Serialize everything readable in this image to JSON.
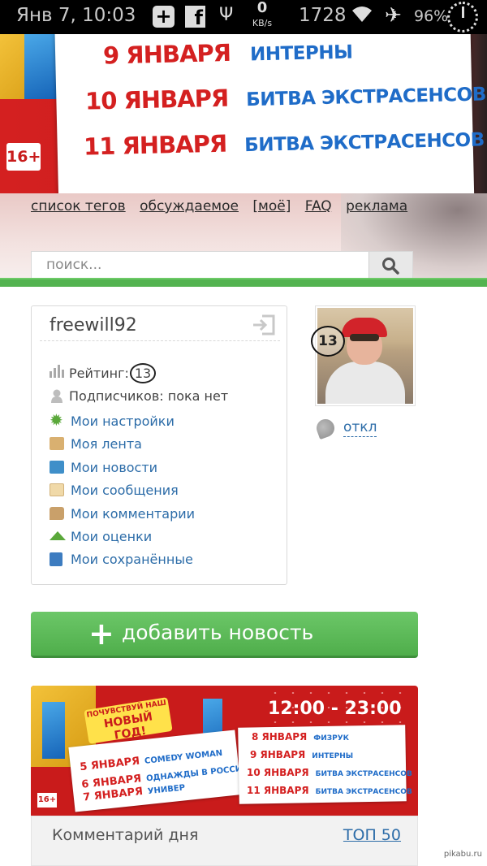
{
  "statusbar": {
    "datetime": "Янв 7, 10:03",
    "speed_value": "0",
    "speed_unit": "KB/s",
    "counter": "1728",
    "battery": "96%"
  },
  "banner": {
    "rows": [
      {
        "date": "9 ЯНВАРЯ",
        "show": "ИНТЕРНЫ"
      },
      {
        "date": "10 ЯНВАРЯ",
        "show": "БИТВА ЭКСТРАСЕНСОВ"
      },
      {
        "date": "11 ЯНВАРЯ",
        "show": "БИТВА ЭКСТРАСЕНСОВ"
      }
    ],
    "age": "16+"
  },
  "nav": {
    "items": [
      "список тегов",
      "обсуждаемое",
      "[моё]",
      "FAQ",
      "реклама"
    ]
  },
  "search": {
    "placeholder": "поиск..."
  },
  "profile": {
    "username": "freewill92",
    "rating_label": "Рейтинг:",
    "rating_value": "13",
    "subscribers": "Подписчиков: пока нет",
    "menu": [
      {
        "label": "Мои настройки",
        "icon": "gear-icon"
      },
      {
        "label": "Моя лента",
        "icon": "scroll-icon"
      },
      {
        "label": "Мои новости",
        "icon": "news-icon"
      },
      {
        "label": "Мои сообщения",
        "icon": "envelope-icon"
      },
      {
        "label": "Мои комментарии",
        "icon": "comment-icon"
      },
      {
        "label": "Мои оценки",
        "icon": "vote-icon"
      },
      {
        "label": "Мои сохранённые",
        "icon": "save-icon"
      }
    ]
  },
  "avatar": {
    "badge": "13",
    "status": "откл"
  },
  "add_news": {
    "label": "добавить новость"
  },
  "banner2": {
    "promo_small": "ПОЧУВСТВУЙ НАШ",
    "promo_big": "НОВЫЙ ГОД!",
    "left": [
      {
        "date": "5 ЯНВАРЯ",
        "show": "COMEDY WOMAN"
      },
      {
        "date": "6 ЯНВАРЯ",
        "show": "ОДНАЖДЫ В РОССИИ"
      },
      {
        "date": "7 ЯНВАРЯ",
        "show": "УНИВЕР"
      }
    ],
    "time": "12:00 - 23:00",
    "right": [
      {
        "date": "8 ЯНВАРЯ",
        "show": "ФИЗРУК"
      },
      {
        "date": "9 ЯНВАРЯ",
        "show": "ИНТЕРНЫ"
      },
      {
        "date": "10 ЯНВАРЯ",
        "show": "БИТВА ЭКСТРАСЕНСОВ"
      },
      {
        "date": "11 ЯНВАРЯ",
        "show": "БИТВА ЭКСТРАСЕНСОВ"
      }
    ],
    "age": "16+"
  },
  "comment_of_day": {
    "title": "Комментарий дня",
    "top_link": "ТОП 50"
  },
  "watermark": "pikabu.ru",
  "colors": {
    "accent_green": "#53b350",
    "link_blue": "#2c6ca8",
    "brand_red": "#c91b1b"
  }
}
